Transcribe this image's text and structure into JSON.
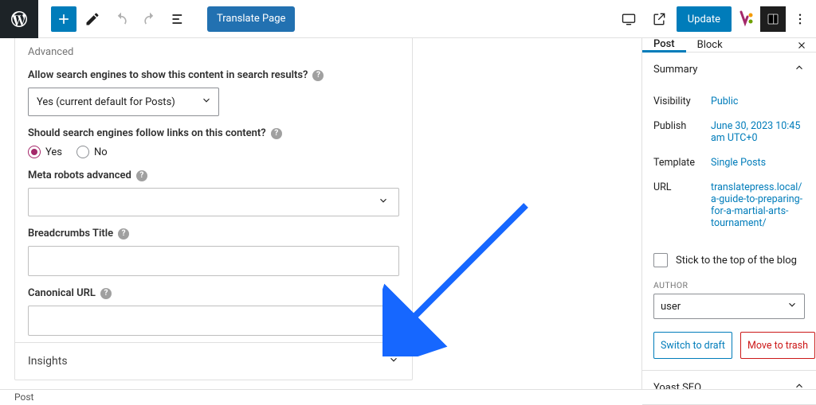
{
  "toolbar": {
    "translate_label": "Translate Page",
    "update_label": "Update"
  },
  "advanced": {
    "section_title": "Advanced",
    "allow_search_label": "Allow search engines to show this content in search results?",
    "allow_search_value": "Yes (current default for Posts)",
    "follow_links_label": "Should search engines follow links on this content?",
    "follow_yes": "Yes",
    "follow_no": "No",
    "meta_robots_label": "Meta robots advanced",
    "breadcrumbs_label": "Breadcrumbs Title",
    "canonical_label": "Canonical URL"
  },
  "insights_label": "Insights",
  "sidebar": {
    "tab_post": "Post",
    "tab_block": "Block",
    "summary_label": "Summary",
    "visibility_k": "Visibility",
    "visibility_v": "Public",
    "publish_k": "Publish",
    "publish_v": "June 30, 2023 10:45 am UTC+0",
    "template_k": "Template",
    "template_v": "Single Posts",
    "url_k": "URL",
    "url_v": "translatepress.local/a-guide-to-preparing-for-a-martial-arts-tournament/",
    "stick_label": "Stick to the top of the blog",
    "author_label": "AUTHOR",
    "author_value": "user",
    "switch_draft": "Switch to draft",
    "move_trash": "Move to trash",
    "yoast_label": "Yoast SEO"
  },
  "footer_crumb": "Post"
}
